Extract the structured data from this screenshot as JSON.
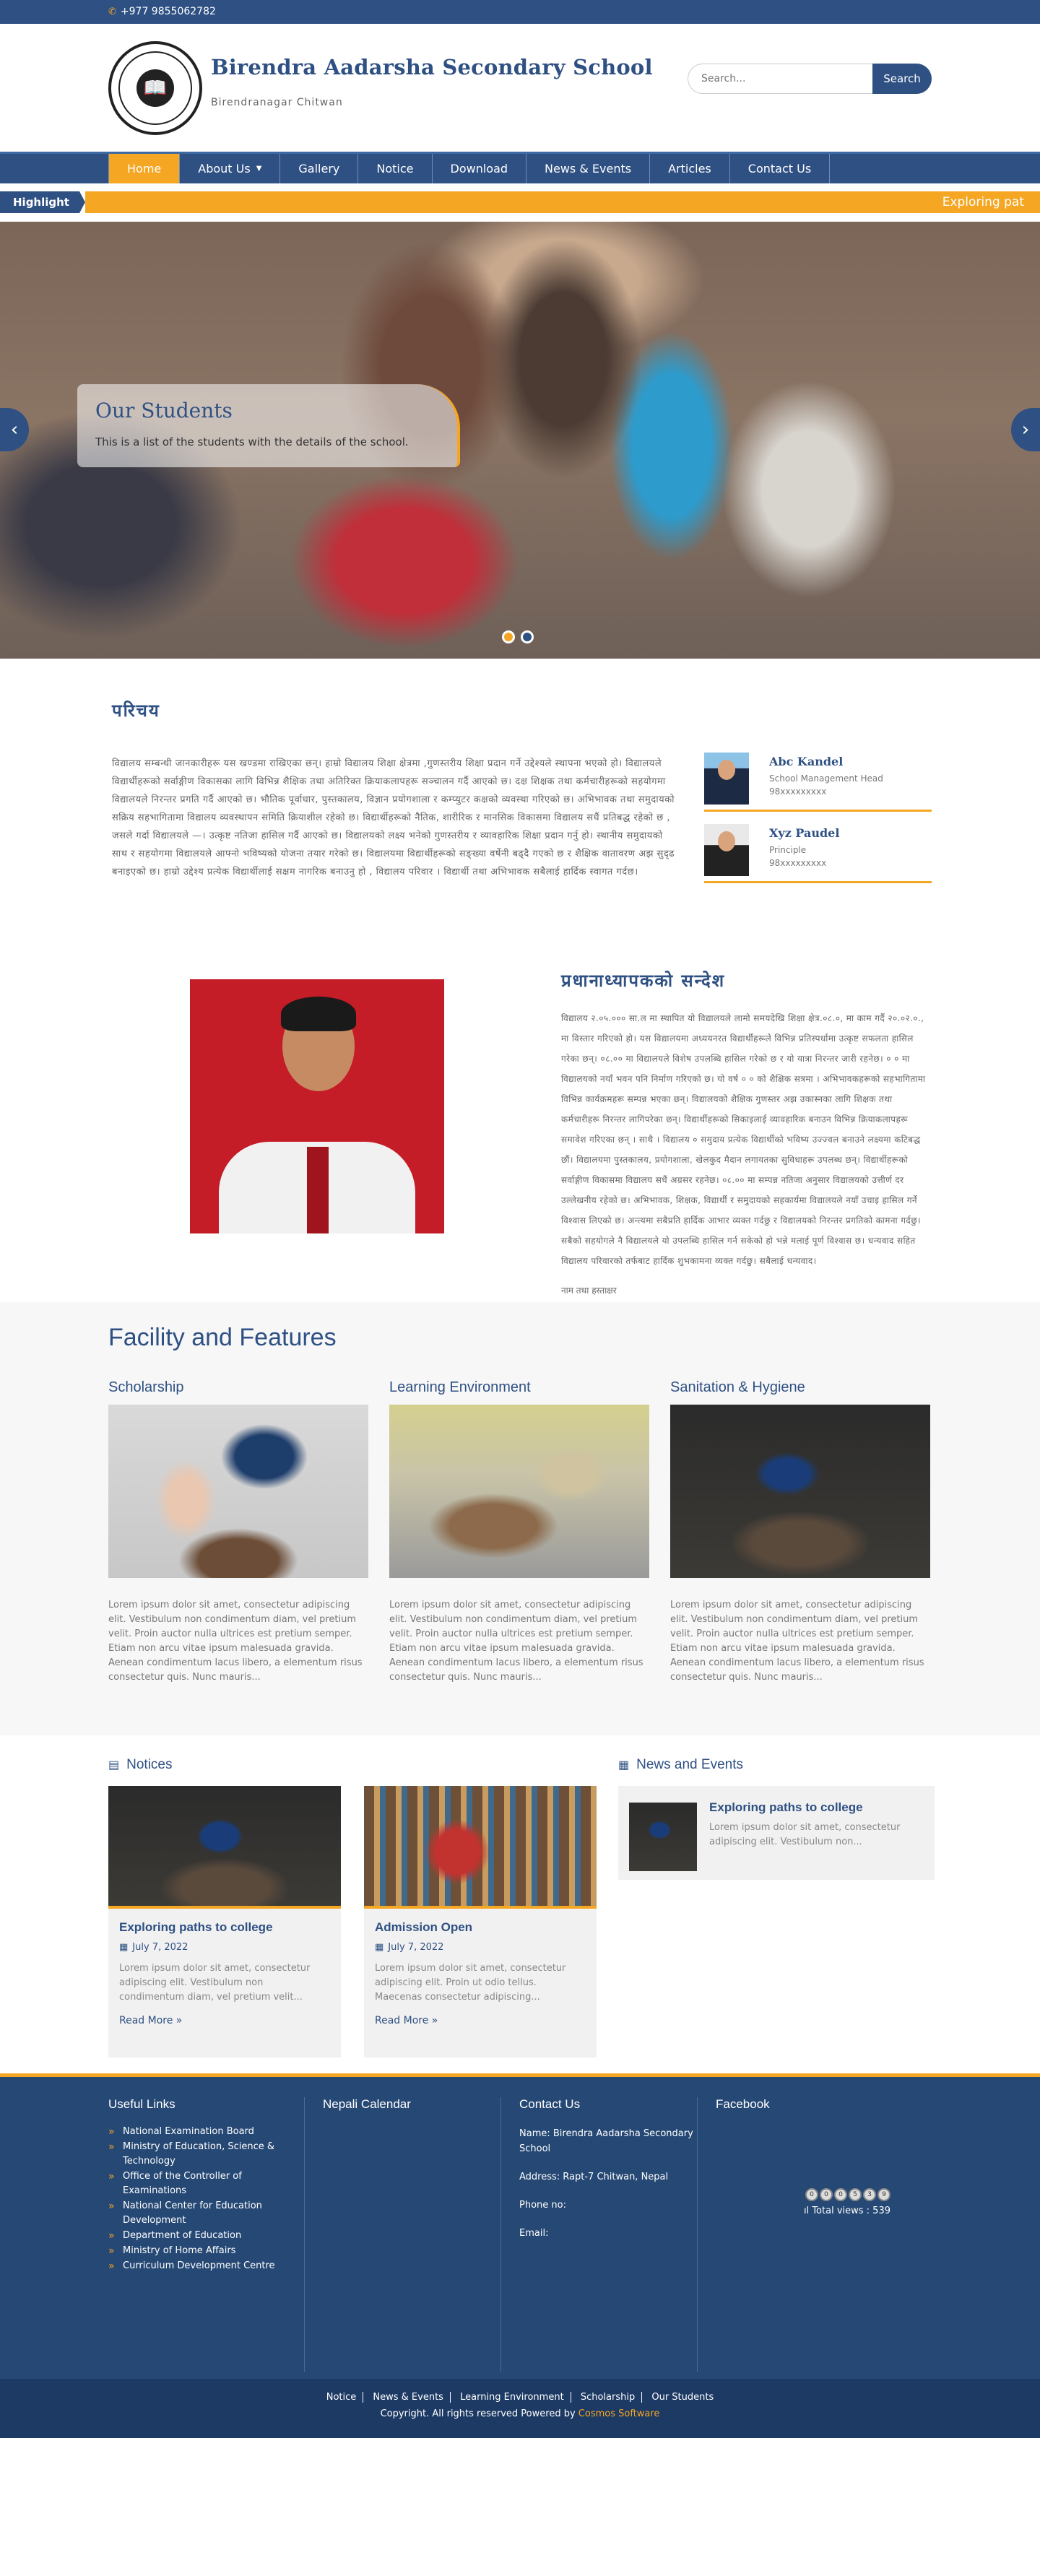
{
  "topbar": {
    "phone": "+977 9855062782"
  },
  "header": {
    "school_name": "Birendra Aadarsha Secondary School",
    "location": "Birendranagar Chitwan",
    "search_placeholder": "Search...",
    "search_button": "Search"
  },
  "nav": {
    "items": [
      "Home",
      "About Us",
      "Gallery",
      "Notice",
      "Download",
      "News & Events",
      "Articles",
      "Contact Us"
    ],
    "active": "Home"
  },
  "highlight": {
    "label": "Highlight",
    "ticker": "Exploring pat"
  },
  "slider": {
    "caption_title": "Our Students",
    "caption_text": "This is a list of the students with the details of the school."
  },
  "about": {
    "heading": "परिचय",
    "paragraph": "विद्यालय सम्बन्धी जानकारीहरू यस खण्डमा राखिएका छन्। हाम्रो विद्यालय शिक्षा क्षेत्रमा ,गुणस्तरीय शिक्षा प्रदान गर्ने उद्देश्यले स्थापना भएको हो। विद्यालयले विद्यार्थीहरूको सर्वाङ्गीण विकासका लागि विभिन्न शैक्षिक तथा अतिरिक्त क्रियाकलापहरू सञ्चालन गर्दै आएको छ। दक्ष शिक्षक तथा कर्मचारीहरूको सहयोगमा विद्यालयले निरन्तर प्रगति गर्दै आएको छ। भौतिक पूर्वाधार, पुस्तकालय, विज्ञान प्रयोगशाला र कम्प्युटर कक्षको व्यवस्था गरिएको छ। अभिभावक तथा समुदायको सक्रिय सहभागितामा विद्यालय व्यवस्थापन समिति क्रियाशील रहेको छ। विद्यार्थीहरूको नैतिक, शारीरिक र मानसिक विकासमा विद्यालय सधैं प्रतिबद्ध रहेको छ , जसले गर्दा विद्यालयले —। उत्कृष्ट नतिजा हासिल गर्दै आएको छ। विद्यालयको लक्ष्य भनेको गुणस्तरीय र व्यावहारिक शिक्षा प्रदान गर्नु हो। स्थानीय समुदायको साथ र सहयोगमा विद्यालयले आफ्नो भविष्यको योजना तयार गरेको छ। विद्यालयमा विद्यार्थीहरूको सङ्ख्या वर्षेनी बढ्दै गएको छ र शैक्षिक वातावरण अझ सुदृढ बनाइएको छ। हाम्रो उद्देश्य प्रत्येक विद्यार्थीलाई सक्षम नागरिक बनाउनु हो , विद्यालय परिवार । विद्यार्थी तथा अभिभावक सबैलाई हार्दिक स्वागत गर्दछ।"
  },
  "staff": [
    {
      "name": "Abc Kandel",
      "role": "School Management Head",
      "phone": "98xxxxxxxxx"
    },
    {
      "name": "Xyz Paudel",
      "role": "Principle",
      "phone": "98xxxxxxxxx"
    }
  ],
  "principal": {
    "heading": "प्रधानाध्यापकको सन्देश",
    "paragraph": "विद्यालय २.०५.००० सा.ल मा स्थापित यो विद्यालयले लामो समयदेखि शिक्षा क्षेत्र.०८.०, मा काम गर्दै २०.०२.०., मा विस्तार गरिएको हो। यस विद्यालयमा अध्ययनरत विद्यार्थीहरूले विभिन्न प्रतिस्पर्धामा उत्कृष्ट सफलता हासिल गरेका छन्। ०८.०० मा विद्यालयले विशेष उपलब्धि हासिल गरेको छ र यो यात्रा निरन्तर जारी रहनेछ। ० ० मा विद्यालयको नयाँ भवन पनि निर्माण गरिएको छ। यो वर्ष ० ० को शैक्षिक सत्रमा । अभिभावकहरूको सहभागितामा विभिन्न कार्यक्रमहरू सम्पन्न भएका छन्। विद्यालयको शैक्षिक गुणस्तर अझ उकास्नका लागि शिक्षक तथा कर्मचारीहरू निरन्तर लागिपरेका छन्। विद्यार्थीहरूको सिकाइलाई व्यावहारिक बनाउन विभिन्न क्रियाकलापहरू समावेश गरिएका छन् । साथै । विद्यालय ० समुदाय प्रत्येक विद्यार्थीको भविष्य उज्ज्वल बनाउने लक्ष्यमा कटिबद्ध छौं। विद्यालयमा पुस्तकालय, प्रयोगशाला, खेलकुद मैदान लगायतका सुविधाहरू उपलब्ध छन्। विद्यार्थीहरूको सर्वाङ्गीण विकासमा विद्यालय सधैं अग्रसर रहनेछ। ०८.०० मा सम्पन्न नतिजा अनुसार विद्यालयको उत्तीर्ण दर उल्लेखनीय रहेको छ। अभिभावक, शिक्षक, विद्यार्थी र समुदायको सहकार्यमा विद्यालयले नयाँ उचाइ हासिल गर्ने विश्वास लिएको छ। अन्त्यमा सबैप्रति हार्दिक आभार व्यक्त गर्दछु र विद्यालयको निरन्तर प्रगतिको कामना गर्दछु। सबैको सहयोगले नै विद्यालयले यो उपलब्धि हासिल गर्न सकेको हो भन्ने मलाई पूर्ण विश्वास छ। धन्यवाद सहित विद्यालय परिवारको तर्फबाट हार्दिक शुभकामना व्यक्त गर्दछु। सबैलाई धन्यवाद।",
    "signature": "नाम तथा हस्ताक्षर"
  },
  "facility": {
    "heading": "Facility and Features",
    "items": [
      {
        "title": "Scholarship",
        "text": "Lorem ipsum dolor sit amet, consectetur adipiscing elit. Vestibulum non condimentum diam, vel pretium velit. Proin auctor nulla ultrices est pretium semper. Etiam non arcu vitae ipsum malesuada gravida. Aenean condimentum lacus libero, a elementum risus consectetur quis. Nunc mauris..."
      },
      {
        "title": "Learning Environment",
        "text": "Lorem ipsum dolor sit amet, consectetur adipiscing elit. Vestibulum non condimentum diam, vel pretium velit. Proin auctor nulla ultrices est pretium semper. Etiam non arcu vitae ipsum malesuada gravida. Aenean condimentum lacus libero, a elementum risus consectetur quis. Nunc mauris..."
      },
      {
        "title": "Sanitation & Hygiene",
        "text": "Lorem ipsum dolor sit amet, consectetur adipiscing elit. Vestibulum non condimentum diam, vel pretium velit. Proin auctor nulla ultrices est pretium semper. Etiam non arcu vitae ipsum malesuada gravida. Aenean condimentum lacus libero, a elementum risus consectetur quis. Nunc mauris..."
      }
    ]
  },
  "notices": {
    "heading": "Notices",
    "items": [
      {
        "title": "Exploring paths to college",
        "date": "July 7, 2022",
        "text": "Lorem ipsum dolor sit amet, consectetur adipiscing elit. Vestibulum non condimentum diam, vel pretium velit...",
        "more": "Read More »"
      },
      {
        "title": "Admission Open",
        "date": "July 7, 2022",
        "text": "Lorem ipsum dolor sit amet, consectetur adipiscing elit. Proin ut odio tellus. Maecenas consectetur adipiscing...",
        "more": "Read More »"
      }
    ]
  },
  "news": {
    "heading": "News and Events",
    "items": [
      {
        "title": "Exploring paths to college",
        "text": "Lorem ipsum dolor sit amet, consectetur adipiscing elit. Vestibulum non..."
      }
    ]
  },
  "footer": {
    "useful_links_heading": "Useful Links",
    "useful_links": [
      "National Examination Board",
      "Ministry of Education, Science & Technology",
      "Office of the Controller of Examinations",
      "National Center for Education Development",
      "Department of Education",
      "Ministry of Home Affairs",
      "Curriculum Development Centre"
    ],
    "calendar_heading": "Nepali Calendar",
    "contact_heading": "Contact Us",
    "contact_name": "Name: Birendra Aadarsha Secondary School",
    "contact_address": "Address: Rapt-7 Chitwan, Nepal",
    "contact_phone": "Phone no:",
    "contact_email": "Email:",
    "facebook_heading": "Facebook",
    "visit_digits": [
      "0",
      "0",
      "0",
      "5",
      "3",
      "9"
    ],
    "total_views": "Total views : 539",
    "bottom_links": [
      "Notice",
      "News & Events",
      "Learning Environment",
      "Scholarship",
      "Our Students"
    ],
    "copyright": "Copyright. All rights reserved Powered by",
    "powered_by": "Cosmos Software"
  },
  "colors": {
    "primary": "#2e5083",
    "accent": "#f5a623",
    "footer": "#264874"
  }
}
